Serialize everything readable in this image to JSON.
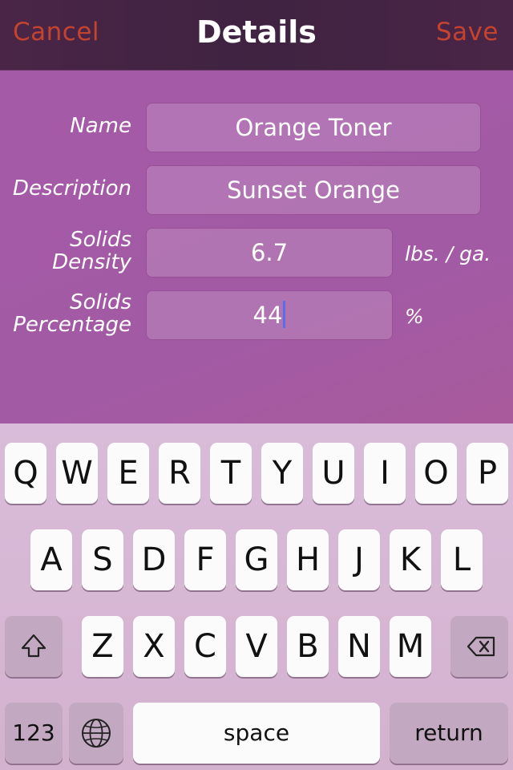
{
  "navbar": {
    "cancel_label": "Cancel",
    "title": "Details",
    "save_label": "Save"
  },
  "form": {
    "name": {
      "label": "Name",
      "value": "Orange Toner"
    },
    "description": {
      "label": "Description",
      "value": "Sunset Orange"
    },
    "solids_density": {
      "label_line1": "Solids",
      "label_line2": "Density",
      "value": "6.7",
      "unit": "lbs. / ga."
    },
    "solids_percentage": {
      "label_line1": "Solids",
      "label_line2": "Percentage",
      "value": "44",
      "unit": "%"
    }
  },
  "keyboard": {
    "row1": [
      "Q",
      "W",
      "E",
      "R",
      "T",
      "Y",
      "U",
      "I",
      "O",
      "P"
    ],
    "row2": [
      "A",
      "S",
      "D",
      "F",
      "G",
      "H",
      "J",
      "K",
      "L"
    ],
    "row3": [
      "Z",
      "X",
      "C",
      "V",
      "B",
      "N",
      "M"
    ],
    "numbers_label": "123",
    "space_label": "space",
    "return_label": "return",
    "shift_icon": "shift-icon",
    "globe_icon": "globe-icon",
    "delete_icon": "delete-icon"
  },
  "colors": {
    "accent": "#c4432f",
    "navbar": "#3f2341",
    "cursor": "#5b6ee8"
  }
}
